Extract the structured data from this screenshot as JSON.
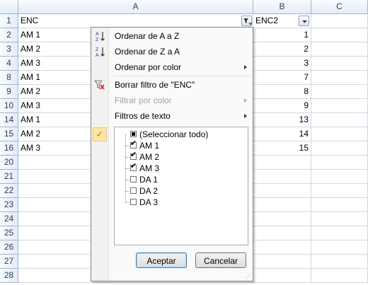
{
  "columns": {
    "a": "A",
    "b": "B",
    "c": "C"
  },
  "rows": [
    {
      "num": "1",
      "a": "ENC",
      "b": "ENC2",
      "header": true
    },
    {
      "num": "2",
      "a": "AM 1",
      "b": "1"
    },
    {
      "num": "3",
      "a": "AM 2",
      "b": "2"
    },
    {
      "num": "4",
      "a": "AM 3",
      "b": "3"
    },
    {
      "num": "8",
      "a": "AM 1",
      "b": "7"
    },
    {
      "num": "9",
      "a": "AM 2",
      "b": "8"
    },
    {
      "num": "10",
      "a": "AM 3",
      "b": "9"
    },
    {
      "num": "14",
      "a": "AM 1",
      "b": "13"
    },
    {
      "num": "15",
      "a": "AM 2",
      "b": "14"
    },
    {
      "num": "16",
      "a": "AM 3",
      "b": "15"
    },
    {
      "num": "20",
      "a": "",
      "b": ""
    },
    {
      "num": "21",
      "a": "",
      "b": ""
    },
    {
      "num": "22",
      "a": "",
      "b": ""
    },
    {
      "num": "23",
      "a": "",
      "b": ""
    },
    {
      "num": "24",
      "a": "",
      "b": ""
    },
    {
      "num": "25",
      "a": "",
      "b": ""
    },
    {
      "num": "26",
      "a": "",
      "b": ""
    },
    {
      "num": "27",
      "a": "",
      "b": ""
    },
    {
      "num": "28",
      "a": "",
      "b": ""
    }
  ],
  "menu": {
    "sort_az": "Ordenar de A a Z",
    "sort_za": "Ordenar de Z a A",
    "sort_color": "Ordenar por color",
    "clear_filter": "Borrar filtro de \"ENC\"",
    "filter_color": "Filtrar por color",
    "text_filters": "Filtros de texto",
    "sort_az_icon_top": "A",
    "sort_az_icon_bottom": "Z",
    "sort_za_icon_top": "Z",
    "sort_za_icon_bottom": "A",
    "check_glyph": "✓"
  },
  "filter_list": [
    {
      "label": "(Seleccionar todo)",
      "state": "partial"
    },
    {
      "label": "AM 1",
      "state": "checked"
    },
    {
      "label": "AM 2",
      "state": "checked"
    },
    {
      "label": "AM 3",
      "state": "checked"
    },
    {
      "label": "DA 1",
      "state": "unchecked"
    },
    {
      "label": "DA 2",
      "state": "unchecked"
    },
    {
      "label": "DA 3",
      "state": "unchecked"
    }
  ],
  "buttons": {
    "accept": "Aceptar",
    "cancel": "Cancelar"
  },
  "icons": {
    "sort_az": "sort-ascending-icon",
    "sort_za": "sort-descending-icon",
    "clear_filter": "clear-filter-icon",
    "filter_button": "filter-dropdown-icon"
  },
  "colors": {
    "header_border": "#9eb6ce",
    "grid": "#d0d7e5",
    "check_bg": "#fbe4a6"
  }
}
